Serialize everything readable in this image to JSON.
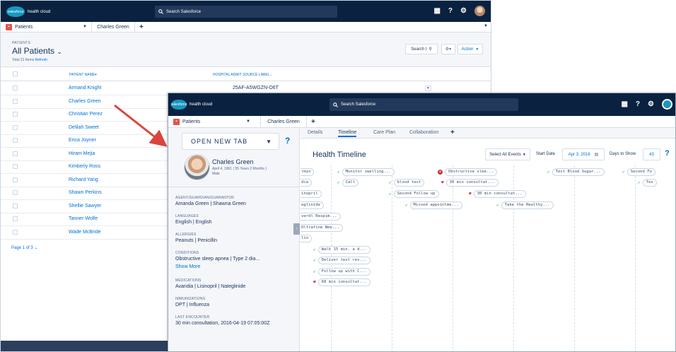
{
  "back_window": {
    "logo_text": "health cloud",
    "logo_badge": "salesforce",
    "search_placeholder": "Search Salesforce",
    "header_icons": [
      "grid-icon",
      "help-icon",
      "gear-icon",
      "avatar"
    ],
    "app_tab": "Patients",
    "sub_tab": "Charles Green",
    "list": {
      "object_label": "PATIENTS",
      "title": "All Patients",
      "total_text": "Total 21 Items",
      "refresh": "Refresh",
      "search_button": "Search t",
      "action_button": "Action",
      "columns": [
        "PATIENT NAME",
        "HOSPITAL ADMIT SOURCE LABEL"
      ],
      "rows": [
        {
          "name": "Armand Knight",
          "code": "25AF-A5WGZN-O6T"
        },
        {
          "name": "Charles Green",
          "code": ""
        },
        {
          "name": "Christian Perez",
          "code": ""
        },
        {
          "name": "Delilah Sweet",
          "code": ""
        },
        {
          "name": "Erica Joyner",
          "code": ""
        },
        {
          "name": "Hiram Mejia",
          "code": ""
        },
        {
          "name": "Kimberly Ross",
          "code": ""
        },
        {
          "name": "Richard Yang",
          "code": ""
        },
        {
          "name": "Shawn Perkins",
          "code": ""
        },
        {
          "name": "Shellie Sawyer",
          "code": ""
        },
        {
          "name": "Tanner Wolfe",
          "code": ""
        },
        {
          "name": "Wade McBride",
          "code": ""
        }
      ],
      "pager": "Page 1 of 3"
    }
  },
  "front_window": {
    "logo_text": "health cloud",
    "logo_badge": "salesforce",
    "search_placeholder": "Search Salesforce",
    "app_tab": "Patients",
    "sub_tab": "Charles Green",
    "side_panel": {
      "new_tab": "OPEN NEW TAB",
      "patient_name": "Charles Green",
      "dob": "April 4, 1961 ( 55 Years 2 Months )",
      "sex": "Male",
      "sections": [
        {
          "label": "AGENT/GUARDIAN/GUARANTOR",
          "value": "Amanda Green | Shawna Green"
        },
        {
          "label": "LANGUAGES",
          "value": "English | English"
        },
        {
          "label": "ALLERGIES",
          "value": "Peanuts | Penicillin"
        },
        {
          "label": "CONDITIONS",
          "value": "Obstructive sleep apnea | Type 2 dia..."
        },
        {
          "label": "MEDICATIONS",
          "value": "Avandia | Lisinopril | Nateglinide"
        },
        {
          "label": "IMMUNIZATIONS",
          "value": "DPT | Influenza"
        },
        {
          "label": "LAST ENCOUNTER",
          "value": "30 min consultation, 2016-04-19 07:05:00Z"
        }
      ],
      "show_more": "Show More"
    },
    "tabs": [
      "Details",
      "Timeline",
      "Care Plan",
      "Collaboration"
    ],
    "active_tab": "Timeline",
    "timeline": {
      "title": "Health Timeline",
      "select_events": "Select All Events",
      "start_date_label": "Start Date",
      "start_date": "Apr 3, 2016",
      "days_label": "Days to Show",
      "days": "43",
      "events": [
        {
          "text": "rmin",
          "marker": "none"
        },
        {
          "text": "Monitor swelling...",
          "marker": "check"
        },
        {
          "text": "Obstructive slee...",
          "marker": "plus"
        },
        {
          "text": "Test Blood Sugar...",
          "marker": "check"
        },
        {
          "text": "Second Fo",
          "marker": "check"
        },
        {
          "text": "dia",
          "marker": "none"
        },
        {
          "text": "Call",
          "marker": "check"
        },
        {
          "text": "blood test",
          "marker": "check"
        },
        {
          "text": "30 min consultat...",
          "marker": "heart"
        },
        {
          "text": "Tes",
          "marker": "check"
        },
        {
          "text": "inopril",
          "marker": "none"
        },
        {
          "text": "Second Follow up",
          "marker": "check"
        },
        {
          "text": "30 min consultat...",
          "marker": "heart"
        },
        {
          "text": "eglinide",
          "marker": "none"
        },
        {
          "text": "Missed appointme...",
          "marker": "check"
        },
        {
          "text": "Take the Healthy...",
          "marker": "check"
        },
        {
          "text": "verdl Respim...",
          "marker": "none"
        },
        {
          "text": "Ultrafine Nee...",
          "marker": "none"
        },
        {
          "text": "lin",
          "marker": "none"
        },
        {
          "text": "Walk 15 min. a d...",
          "marker": "check"
        },
        {
          "text": "Deliver test res...",
          "marker": "check"
        },
        {
          "text": "Follow up with C...",
          "marker": "check"
        },
        {
          "text": "60 min consultat...",
          "marker": "heart"
        }
      ]
    }
  },
  "colors": {
    "header_bg": "#0a2240",
    "link_blue": "#0070d2",
    "check_green": "#4bca81",
    "heart_red": "#c23934",
    "arrow_red": "#d9453d"
  }
}
